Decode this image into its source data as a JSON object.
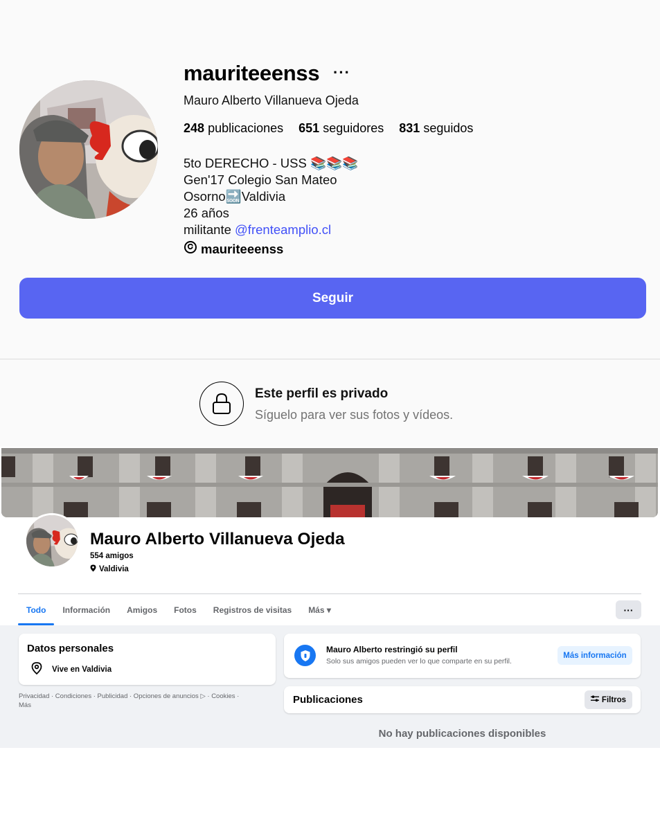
{
  "instagram": {
    "username": "mauriteeenss",
    "more_label": "···",
    "full_name": "Mauro Alberto Villanueva Ojeda",
    "stats": [
      {
        "value": "248",
        "label": "publicaciones"
      },
      {
        "value": "651",
        "label": "seguidores"
      },
      {
        "value": "831",
        "label": "seguidos"
      }
    ],
    "bio": {
      "line1": "5to DERECHO - USS 📚📚📚",
      "line2": "Gen'17 Colegio San Mateo",
      "line3": "Osorno🔜Valdivia",
      "line4": "26 años",
      "line5_prefix": "militante ",
      "line5_link": "@frenteamplio.cl"
    },
    "threads_handle": "mauriteeenss",
    "follow_label": "Seguir",
    "private_title": "Este perfil es privado",
    "private_subtitle": "Síguelo para ver sus fotos y vídeos."
  },
  "facebook": {
    "name": "Mauro Alberto Villanueva Ojeda",
    "friends": "554 amigos",
    "location": "Valdivia",
    "tabs": [
      {
        "label": "Todo"
      },
      {
        "label": "Información"
      },
      {
        "label": "Amigos"
      },
      {
        "label": "Fotos"
      },
      {
        "label": "Registros de visitas"
      },
      {
        "label": "Más ▾"
      }
    ],
    "more_btn_label": "···",
    "personal_title": "Datos personales",
    "lives_in": "Vive en Valdivia",
    "footer_line1": "Privacidad · Condiciones · Publicidad · Opciones de anuncios ▷ · Cookies ·",
    "footer_line2": "Más",
    "restricted_title": "Mauro Alberto restringió su perfil",
    "restricted_subtitle": "Solo sus amigos pueden ver lo que comparte en su perfil.",
    "more_info_label": "Más información",
    "posts_title": "Publicaciones",
    "filters_label": "Filtros",
    "no_posts": "No hay publicaciones disponibles"
  },
  "colors": {
    "ig_follow": "#5865f2",
    "ig_link": "#4150f7",
    "fb_blue": "#1877f2"
  },
  "icons": [
    "lock-icon",
    "threads-icon",
    "location-pin-icon",
    "shield-icon",
    "filter-icon"
  ]
}
